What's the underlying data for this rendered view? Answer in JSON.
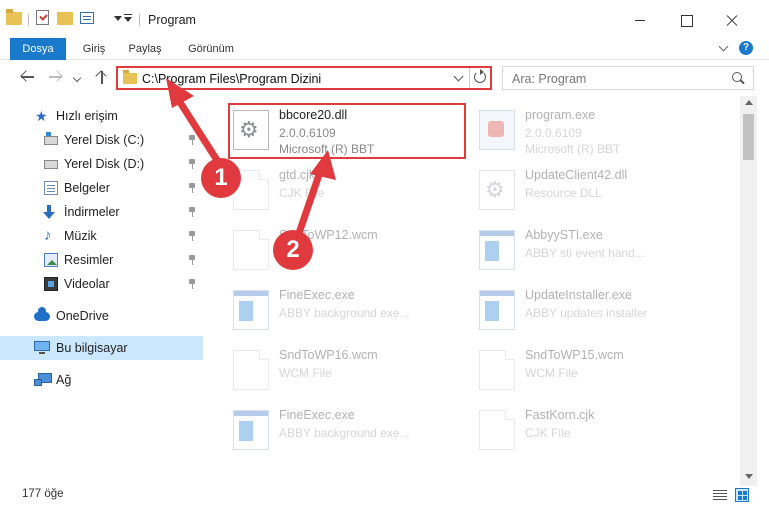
{
  "window": {
    "title": "Program"
  },
  "ribbon": {
    "tabs": [
      "Dosya",
      "Giriş",
      "Paylaş",
      "Görünüm"
    ]
  },
  "address": {
    "path": "C:\\Program Files\\Program Dizini"
  },
  "search": {
    "placeholder": "Ara: Program"
  },
  "sidebar": {
    "items": [
      {
        "label": "Hızlı erişim",
        "icon": "star-icon"
      },
      {
        "label": "Yerel Disk (C:)",
        "icon": "drive-icon"
      },
      {
        "label": "Yerel Disk (D:)",
        "icon": "drive-icon"
      },
      {
        "label": "Belgeler",
        "icon": "documents-icon"
      },
      {
        "label": "İndirmeler",
        "icon": "download-icon"
      },
      {
        "label": "Müzik",
        "icon": "music-icon"
      },
      {
        "label": "Resimler",
        "icon": "pictures-icon"
      },
      {
        "label": "Videolar",
        "icon": "videos-icon"
      },
      {
        "label": "OneDrive",
        "icon": "cloud-icon"
      },
      {
        "label": "Bu bilgisayar",
        "icon": "computer-icon"
      },
      {
        "label": "Ağ",
        "icon": "network-icon"
      }
    ]
  },
  "files": [
    {
      "name": "bbcore20.dll",
      "line2": "2.0.0.6109",
      "line3": "Microsoft (R) BBT",
      "icon": "dll-icon"
    },
    {
      "name": "program.exe",
      "line2": "2.0.0.6109",
      "line3": "Microsoft (R) BBT",
      "icon": "exe-icon"
    },
    {
      "name": "gtd.cjk",
      "line2": "CJK File",
      "line3": "",
      "icon": "file-icon"
    },
    {
      "name": "UpdateClient42.dll",
      "line2": "Resource DLL",
      "line3": "",
      "icon": "dll-icon"
    },
    {
      "name": "SndToWP12.wcm",
      "line2": "",
      "line3": "",
      "icon": "file-icon"
    },
    {
      "name": "AbbyySTI.exe",
      "line2": "ABBY sti event hand...",
      "line3": "",
      "icon": "app-icon"
    },
    {
      "name": "FineExec.exe",
      "line2": "ABBY background exe...",
      "line3": "",
      "icon": "app-icon"
    },
    {
      "name": "UpdateInstaller.exe",
      "line2": "ABBY updates installer",
      "line3": "",
      "icon": "app-icon"
    },
    {
      "name": "SndToWP16.wcm",
      "line2": "WCM File",
      "line3": "",
      "icon": "file-icon"
    },
    {
      "name": "SndToWP15.wcm",
      "line2": "WCM File",
      "line3": "",
      "icon": "file-icon"
    },
    {
      "name": "FineExec.exe",
      "line2": "ABBY background exe...",
      "line3": "",
      "icon": "app-icon"
    },
    {
      "name": "FastKorn.cjk",
      "line2": "CJK File",
      "line3": "",
      "icon": "file-icon"
    }
  ],
  "status": {
    "count": "177 öğe"
  },
  "annotations": {
    "step1": "1",
    "step2": "2"
  },
  "colors": {
    "accent": "#1979ca",
    "highlight": "#e0393e",
    "selection": "#cce8ff"
  }
}
